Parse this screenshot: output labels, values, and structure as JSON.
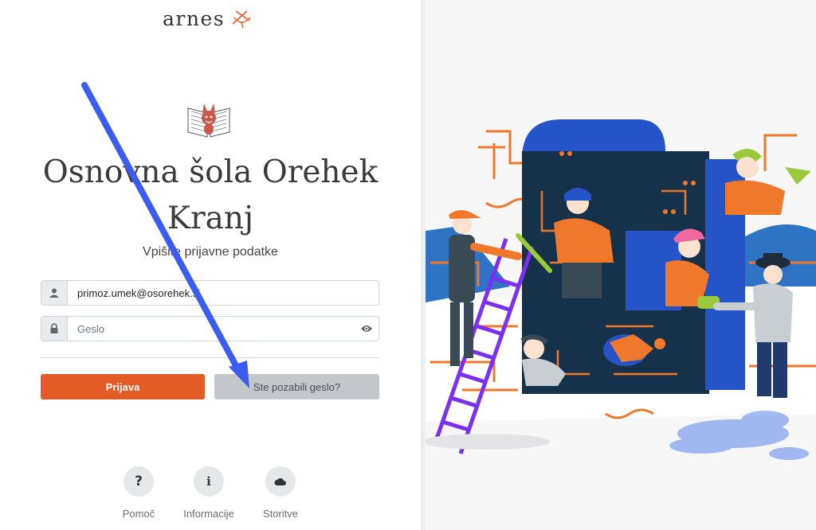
{
  "brand": {
    "name": "arnes"
  },
  "school": {
    "name": "Osnovna šola Orehek Kranj"
  },
  "login": {
    "subtitle": "Vpišite prijavne podatke",
    "email_value": "primoz.umek@osorehek.si",
    "password_placeholder": "Geslo",
    "login_label": "Prijava",
    "forgot_label": "Ste pozabili geslo?"
  },
  "footer": {
    "items": [
      {
        "label": "Pomoč",
        "icon": "question-icon",
        "glyph": "?"
      },
      {
        "label": "Informacije",
        "icon": "info-icon",
        "glyph": "i"
      },
      {
        "label": "Storitve",
        "icon": "cloud-icon",
        "glyph": ""
      }
    ]
  },
  "colors": {
    "primary_button": "#e35b27",
    "secondary_button": "#c3c6ca",
    "annotation_arrow": "#3b5cf0"
  },
  "illustration": {
    "name": "team-repairing-machine-illustration"
  }
}
